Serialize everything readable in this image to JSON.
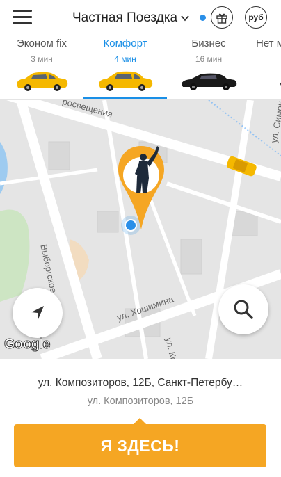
{
  "header": {
    "title": "Частная Поездка",
    "currency_label": "руб",
    "icons": [
      "menu-icon",
      "chevron-down-icon",
      "gift-icon"
    ]
  },
  "tariffs": [
    {
      "name": "Эконом fix",
      "eta": "3 мин",
      "car_color": "#f5b800",
      "active": false
    },
    {
      "name": "Комфорт",
      "eta": "4 мин",
      "car_color": "#f5b800",
      "active": true
    },
    {
      "name": "Бизнес",
      "eta": "16 мин",
      "car_color": "#1a1a1a",
      "active": false
    },
    {
      "name": "Нет м",
      "eta": "",
      "car_color": "#1a1a1a",
      "active": false
    }
  ],
  "map": {
    "streets": {
      "prosvescheniya": "росвещения",
      "vyborgskoe": "Выборгское ш",
      "hoshimina": "ул. Хошимина",
      "simon": "ул. Симон",
      "kom": "ул. Ком"
    },
    "attribution": "Google"
  },
  "address": {
    "main": "ул. Композиторов, 12Б, Санкт-Петербу…",
    "sub": "ул. Композиторов, 12Б"
  },
  "actions": {
    "confirm_label": "Я ЗДЕСЬ!"
  },
  "colors": {
    "accent": "#1a8fe6",
    "button": "#f5a623"
  }
}
